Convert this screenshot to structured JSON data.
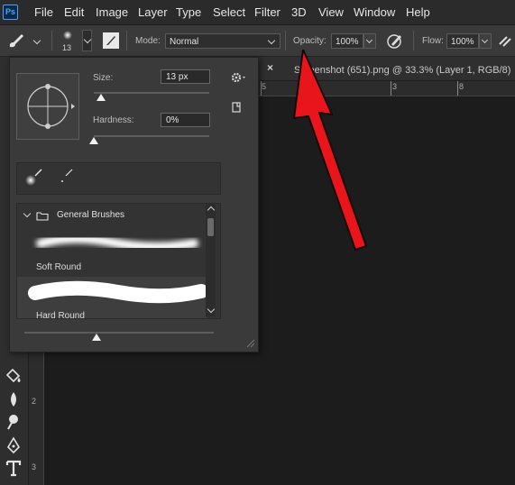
{
  "app": {
    "logo_text": "Ps"
  },
  "menu": [
    "File",
    "Edit",
    "Image",
    "Layer",
    "Type",
    "Select",
    "Filter",
    "3D",
    "View",
    "Window",
    "Help"
  ],
  "options_bar": {
    "brush_size_badge": "13",
    "mode_label": "Mode:",
    "mode_value": "Normal",
    "opacity_label": "Opacity:",
    "opacity_value": "100%",
    "flow_label": "Flow:",
    "flow_value": "100%"
  },
  "document_tab": {
    "close_glyph": "×",
    "title": "Screenshot (651).png @ 33.3% (Layer 1, RGB/8)"
  },
  "ruler_top": {
    "labels": [
      "5",
      "1",
      "3",
      "8"
    ]
  },
  "ruler_left": {
    "labels": [
      "2",
      "3"
    ]
  },
  "brush_panel": {
    "size_label": "Size:",
    "size_value": "13 px",
    "hardness_label": "Hardness:",
    "hardness_value": "0%",
    "size_slider_fraction": 0.06,
    "hardness_slider_fraction": 0.0,
    "spacing_slider_fraction": 0.38,
    "group_name": "General Brushes",
    "brushes": [
      {
        "name": "Soft Round"
      },
      {
        "name": "Hard Round"
      }
    ]
  },
  "colors": {
    "accent_arrow": "#e8161b",
    "panel_bg": "#3a3a3a"
  }
}
